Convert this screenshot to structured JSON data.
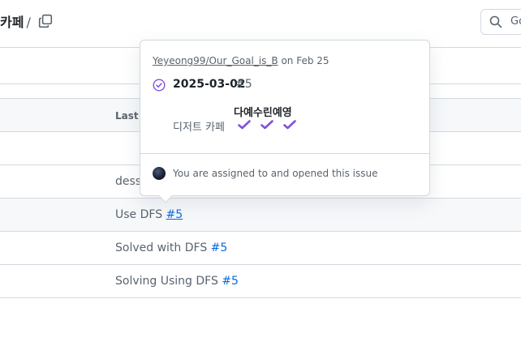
{
  "header": {
    "breadcrumb_tail": "카페",
    "breadcrumb_sep": "/",
    "search_placeholder": "Go"
  },
  "table": {
    "column_header": "Last commit message",
    "rows": [
      {
        "message": "",
        "issue_ref": ""
      },
      {
        "message": "dessert cafe",
        "issue_ref": ""
      },
      {
        "message": "Use DFS ",
        "issue_ref": "#5"
      },
      {
        "message": "Solved with DFS ",
        "issue_ref": "#5"
      },
      {
        "message": "Solving Using DFS ",
        "issue_ref": "#5"
      }
    ]
  },
  "popover": {
    "repo": "Yeyeong99/Our_Goal_is_B",
    "repo_suffix": " on Feb 25",
    "issue_title": "2025-03-02",
    "issue_number": "#5",
    "body_top": "다예수린예영",
    "body_left": "디저트 카페",
    "check_count": 3,
    "footer": "You are assigned to and opened this issue",
    "colors": {
      "status": "#8250df",
      "check": "#8250df"
    }
  }
}
